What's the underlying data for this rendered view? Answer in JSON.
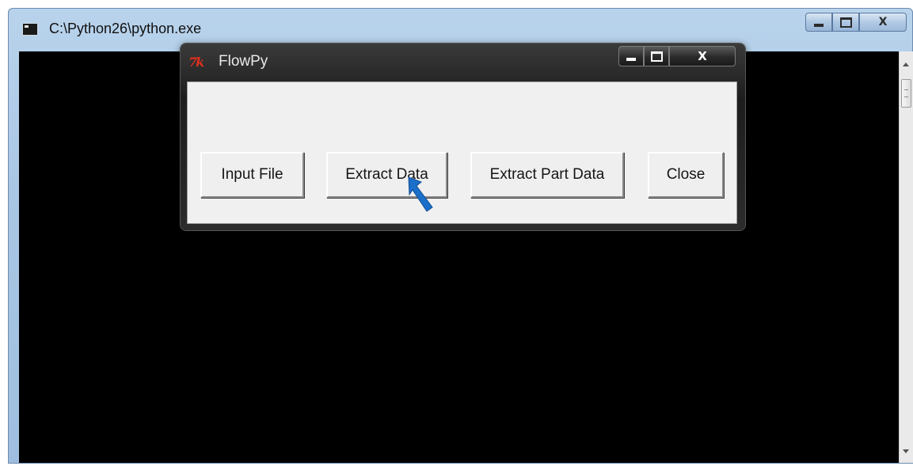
{
  "console_window": {
    "title": "C:\\Python26\\python.exe",
    "controls": {
      "minimize_icon": "minimize-icon",
      "maximize_icon": "maximize-icon",
      "close_label": "X"
    }
  },
  "dialog": {
    "title": "FlowPy",
    "icon": "tk-feather-icon",
    "controls": {
      "minimize_icon": "minimize-icon",
      "maximize_icon": "maximize-icon",
      "close_label": "X"
    },
    "buttons": [
      {
        "label": "Input File"
      },
      {
        "label": "Extract Data"
      },
      {
        "label": "Extract Part Data"
      },
      {
        "label": "Close"
      }
    ]
  },
  "colors": {
    "console_background": "#000000",
    "dialog_frame": "#1d1d1d",
    "dialog_client": "#f0f0f0",
    "pointer": "#1c6fc9"
  }
}
